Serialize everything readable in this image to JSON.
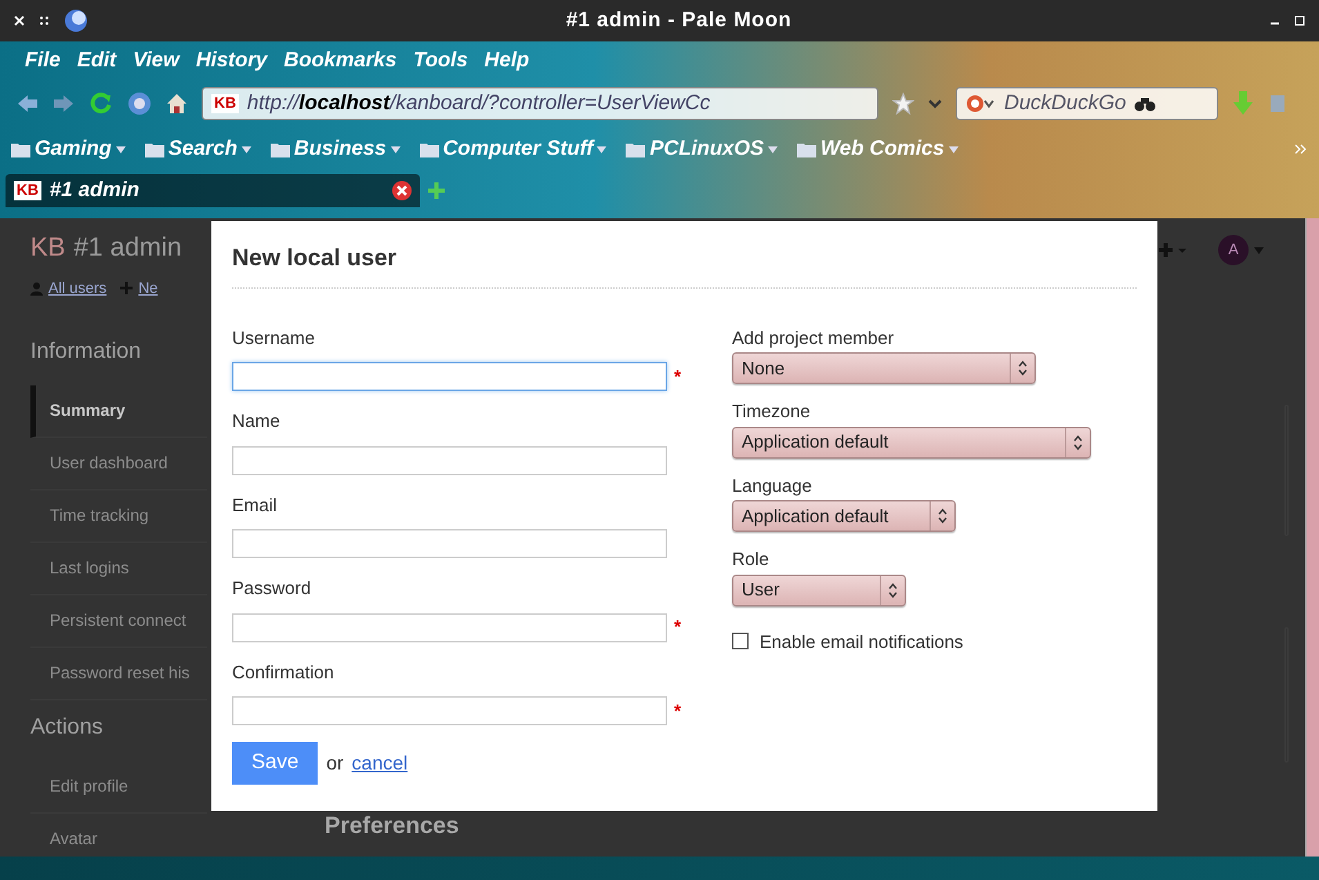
{
  "window": {
    "title": "#1 admin - Pale Moon"
  },
  "menu": [
    "File",
    "Edit",
    "View",
    "History",
    "Bookmarks",
    "Tools",
    "Help"
  ],
  "address_bar": {
    "favicon": "KB",
    "url": "http://**localhost**/kanboard/?controller=UserViewCc"
  },
  "search_bar": {
    "value": "DuckDuckGo"
  },
  "bookmarks": [
    "Gaming",
    "Search",
    "Business",
    "Computer Stuff",
    "PCLinuxOS",
    "Web Comics"
  ],
  "tabs": [
    {
      "favicon": "KB",
      "label": "#1 admin",
      "selected": true
    }
  ],
  "page": {
    "logo": "KB",
    "title": "#1 admin",
    "links": [
      "All users",
      "Ne"
    ],
    "avatar": "A",
    "sections": [
      {
        "heading": "Information",
        "items": [
          {
            "label": "Summary",
            "selected": true
          },
          {
            "label": "User dashboard",
            "selected": false
          },
          {
            "label": "Time tracking",
            "selected": false
          },
          {
            "label": "Last logins",
            "selected": false
          },
          {
            "label": "Persistent connect",
            "selected": false
          },
          {
            "label": "Password reset his",
            "selected": false
          }
        ]
      },
      {
        "heading": "Actions",
        "items": [
          {
            "label": "Edit profile",
            "selected": false
          },
          {
            "label": "Avatar",
            "selected": false
          }
        ]
      }
    ],
    "behind_heading": "Preferences"
  },
  "dialog": {
    "title": "New local user",
    "fields": [
      {
        "label": "Username",
        "marker": "*",
        "focused": true
      },
      {
        "label": "Name",
        "focused": false
      },
      {
        "label": "Email",
        "focused": false
      },
      {
        "label": "Password",
        "marker": "*",
        "focused": false
      },
      {
        "label": "Confirmation",
        "marker": "*",
        "focused": false
      }
    ],
    "selects": [
      {
        "label": "Add project member",
        "value": "None"
      },
      {
        "label": "Timezone",
        "value": "Application default"
      },
      {
        "label": "Language",
        "value": "Application default"
      },
      {
        "label": "Role",
        "value": "User"
      }
    ],
    "checkbox": {
      "label": "Enable email notifications",
      "checked": false
    },
    "save": "Save",
    "or": "or",
    "cancel": "cancel"
  }
}
